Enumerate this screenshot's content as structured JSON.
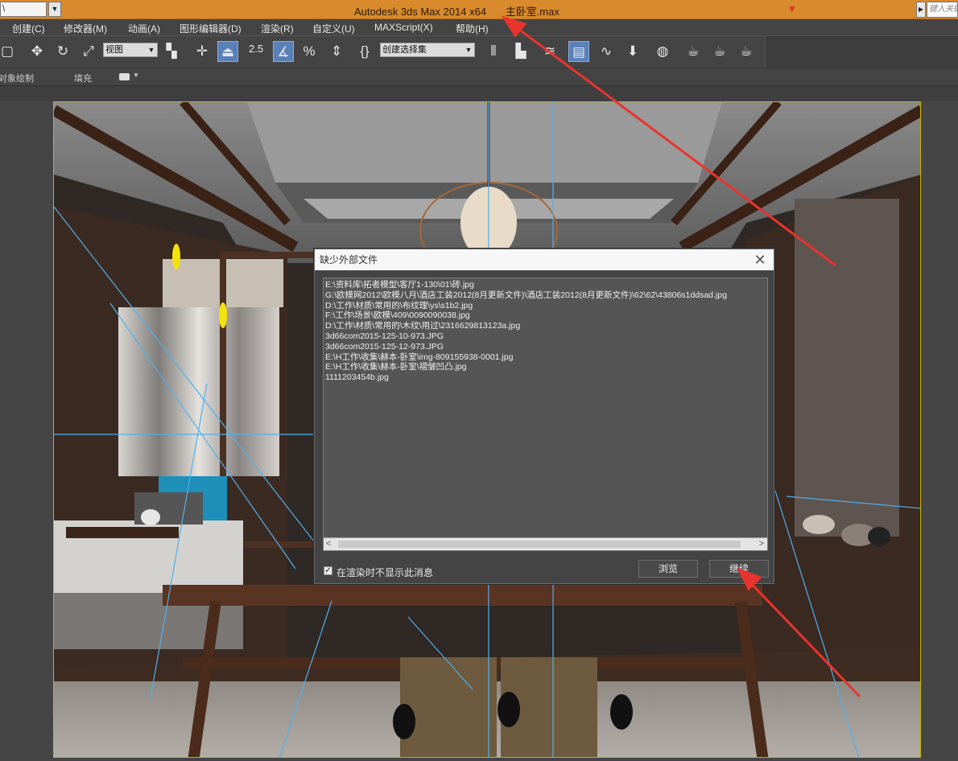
{
  "titlebar": {
    "combo_value": "\\",
    "app_title": "Autodesk 3ds Max  2014 x64",
    "file_name": "主卧室.max",
    "search_placeholder": "键入关键字"
  },
  "menu": {
    "items": [
      "创建(C)",
      "修改器(M)",
      "动画(A)",
      "图形编辑器(D)",
      "渲染(R)",
      "自定义(U)",
      "MAXScript(X)",
      "帮助(H)"
    ]
  },
  "toolbar": {
    "view_select": "视图",
    "snap_value": "2.5",
    "selection_set": "创建选择集"
  },
  "ribbon": {
    "object_paint": "对象绘制",
    "fill": "填充"
  },
  "dialog": {
    "title": "缺少外部文件",
    "files": [
      "E:\\资料库\\拓者模型\\客厅1-130\\01\\砖.jpg",
      "G:\\欧模网2012\\欧模八月\\酒店工装2012(8月更新文件)\\酒店工装2012(8月更新文件)\\62\\62\\43806s1ddsad.jpg",
      "D:\\工作\\材质\\常用的\\布纹理\\ys\\s1b2.jpg",
      "F:\\工作\\场景\\欧模\\409\\0090090038.jpg",
      "D:\\工作\\材质\\常用的\\木纹\\用过\\2316629813123a.jpg",
      "3d66com2015-125-10-973.JPG",
      "3d66com2015-125-12-973.JPG",
      "E:\\H工作\\收集\\赫本-卧室\\img-809155938-0001.jpg",
      "E:\\H工作\\收集\\赫本-卧室\\褶皱凹凸.jpg",
      "1111203454b.jpg"
    ],
    "checkbox_label": "在渲染时不显示此消息",
    "checkbox_checked": true,
    "browse_label": "浏览",
    "continue_label": "继续"
  },
  "colors": {
    "titlebar": "#d88a2c",
    "annotation_arrow": "#e8342e",
    "active_tool": "#5a80b8"
  }
}
